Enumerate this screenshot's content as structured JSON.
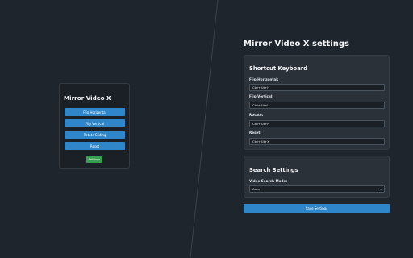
{
  "popup": {
    "title": "Mirror Video X",
    "buttons": [
      "Flip Horizontal",
      "Flip Vertical",
      "Rotate Sliding",
      "Reset"
    ],
    "settings_label": "Settings"
  },
  "settings": {
    "title": "Mirror Video X settings",
    "shortcut_card": {
      "title": "Shortcut Keyboard",
      "fields": [
        {
          "label": "Flip Horizontal:",
          "value": "Ctrl+Alt+H"
        },
        {
          "label": "Flip Vertical:",
          "value": "Ctrl+Alt+V"
        },
        {
          "label": "Rotate:",
          "value": "Ctrl+Alt+R"
        },
        {
          "label": "Reset:",
          "value": "Ctrl+Alt+X"
        }
      ]
    },
    "search_card": {
      "title": "Search Settings",
      "mode_label": "Video Search Mode:",
      "mode_value": "Auto"
    },
    "save_label": "Save Settings"
  },
  "colors": {
    "background": "#1f252c",
    "card": "#2a3139",
    "primary_button": "#2f86c8",
    "settings_button": "#35a04d"
  }
}
